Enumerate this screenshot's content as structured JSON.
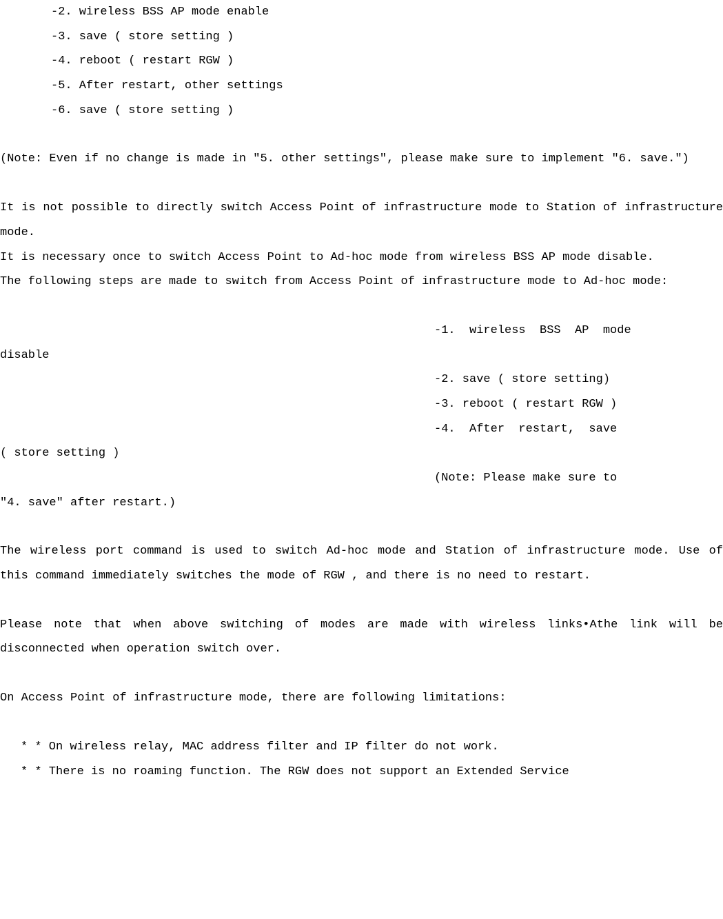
{
  "steps_top": {
    "s2": "-2. wireless BSS AP mode enable",
    "s3": "-3. save ( store setting )",
    "s4": "-4. reboot ( restart RGW )",
    "s5": "-5. After restart, other settings",
    "s6": "-6. save ( store setting )"
  },
  "note1": "(Note: Even if no change is made in \"5. other settings\", please make sure to implement \"6. save.\")",
  "para1": "It is not possible to directly switch Access Point of infrastructure mode to Station of infrastructure mode.",
  "para2": "It is necessary once to switch Access Point to Ad-hoc mode from wireless BSS AP mode disable.",
  "para3": "The following steps are made to switch from Access Point of infrastructure mode to Ad-hoc mode:",
  "steps_mid": {
    "s1_right": "-1.  wireless  BSS  AP  mode",
    "s1_left": "disable",
    "s2": "-2. save ( store setting)",
    "s3": "-3. reboot ( restart RGW )",
    "s4_right": "-4.  After  restart,  save",
    "s4_left": "( store setting )",
    "note_right": "(Note: Please make sure to",
    "note_left": "\"4. save\" after restart.)"
  },
  "para4": "The wireless port command is used to switch Ad-hoc mode and Station of infrastructure mode. Use of this command immediately switches the mode of RGW , and there is no need to restart.",
  "para5": "Please note that when above switching of modes are made with wireless links•Athe link will be disconnected when operation switch over.",
  "para6": "On Access Point of infrastructure mode, there are following limitations:",
  "bullets": {
    "b1": "*   * On wireless relay, MAC address filter and IP filter do not work.",
    "b2": "*   * There is no roaming function. The RGW does not support an Extended Service"
  }
}
